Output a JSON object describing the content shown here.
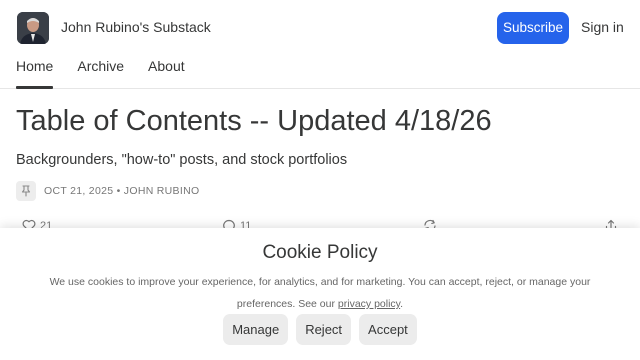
{
  "header": {
    "site_name": "John Rubino's Substack",
    "subscribe_label": "Subscribe",
    "signin_label": "Sign in"
  },
  "nav": {
    "tabs": [
      {
        "label": "Home",
        "active": true
      },
      {
        "label": "Archive",
        "active": false
      },
      {
        "label": "About",
        "active": false
      }
    ]
  },
  "post": {
    "title": "Table of Contents -- Updated 4/18/26",
    "subtitle": "Backgrounders, \"how-to\" posts, and stock portfolios",
    "date": "OCT 21, 2025",
    "separator": "•",
    "author": "JOHN RUBINO",
    "likes": "21",
    "comments": "11",
    "icons": {
      "meta": "pin-icon",
      "like": "heart-icon",
      "comment": "comment-icon",
      "restack": "restack-icon",
      "share": "share-icon"
    }
  },
  "cookie": {
    "title": "Cookie Policy",
    "text_before": "We use cookies to improve your experience, for analytics, and for marketing. You can accept, reject, or manage your preferences. See our ",
    "link": "privacy policy",
    "text_after": ".",
    "buttons": {
      "manage": "Manage",
      "reject": "Reject",
      "accept": "Accept"
    }
  },
  "colors": {
    "accent": "#2563eb",
    "text": "#363737",
    "muted": "#777777"
  }
}
